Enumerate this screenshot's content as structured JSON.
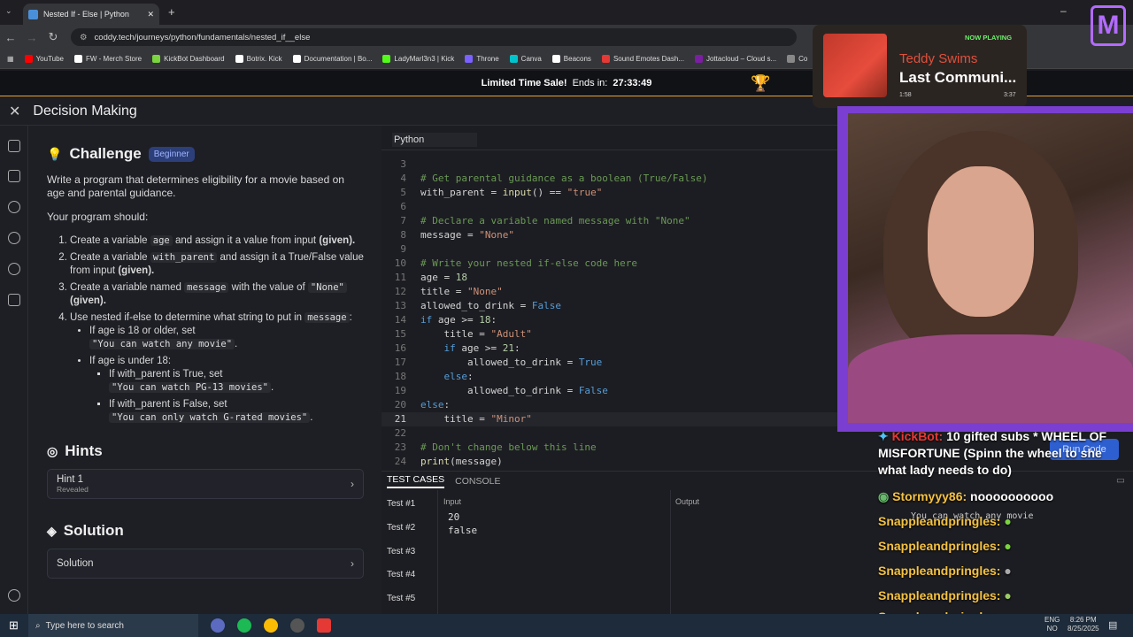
{
  "browser": {
    "tab_title": "Nested If - Else | Python",
    "url": "coddy.tech/journeys/python/fundamentals/nested_if__else",
    "bookmarks": [
      "YouTube",
      "FW - Merch Store",
      "KickBot Dashboard",
      "Botrix. Kick",
      "Documentation | Bo...",
      "LadyMarl3n3 | Kick",
      "Throne",
      "Canva",
      "Beacons",
      "Sound Emotes Dash...",
      "Jottacloud – Cloud s...",
      "Co"
    ],
    "bookmark_colors": [
      "#ff0000",
      "#ffffff",
      "#7ad53e",
      "#ffffff",
      "#ffffff",
      "#53fc18",
      "#7b61ff",
      "#00c4cc",
      "#ffffff",
      "#e53935",
      "#7b1fa2",
      "#888888"
    ]
  },
  "sale": {
    "label": "Limited Time Sale!",
    "ends": "Ends in:",
    "timer": "27:33:49"
  },
  "app": {
    "title": "Decision Making"
  },
  "challenge": {
    "title": "Challenge",
    "level": "Beginner",
    "intro": "Write a program that determines eligibility for a movie based on age and parental guidance.",
    "should": "Your program should:",
    "step1a": "Create a variable",
    "step1code": "age",
    "step1b": "and assign it a value from input",
    "step1given": "(given).",
    "step2a": "Create a variable",
    "step2code": "with_parent",
    "step2b": "and assign it a True/False value from input",
    "step2given": "(given).",
    "step3a": "Create a variable named",
    "step3code": "message",
    "step3b": "with the value of",
    "step3code2": "\"None\"",
    "step3given": "(given).",
    "step4a": "Use nested if-else to determine what string to put in",
    "step4code": "message",
    "step4b": ":",
    "sub1": "If age is 18 or older, set",
    "sub1code": "\"You can watch any movie\"",
    "sub2": "If age is under 18:",
    "subsub1": "If with_parent is True, set",
    "subsub1code": "\"You can watch PG-13 movies\"",
    "subsub2": "If with_parent is False, set",
    "subsub2code": "\"You can only watch G-rated movies\""
  },
  "hints": {
    "title": "Hints",
    "item_label": "Hint 1",
    "item_status": "Revealed"
  },
  "solution": {
    "title": "Solution",
    "item_label": "Solution"
  },
  "editor": {
    "language": "Python"
  },
  "tests": {
    "tab_cases": "TEST CASES",
    "tab_console": "CONSOLE",
    "col_input": "Input",
    "col_output": "Output",
    "items": [
      "Test #1",
      "Test #2",
      "Test #3",
      "Test #4",
      "Test #5"
    ],
    "input_line1": "20",
    "input_line2": "false"
  },
  "run_button": "Run Code",
  "expected_value": "You can watch any movie",
  "nowplaying": {
    "status": "NOW PLAYING",
    "artist": "Teddy Swims",
    "song": "Last Communi...",
    "elapsed": "1:58",
    "duration": "3:37"
  },
  "chat": {
    "bot_name": "KickBot:",
    "bot_text": "10 gifted subs * WHEEL OF MISFORTUNE (Spinn the wheel to she what lady needs to do)",
    "user1": "Stormyyy86:",
    "user1_text": "noooooooooo",
    "user2": "Snappleandpringles:"
  },
  "taskbar": {
    "search": "Type here to search",
    "lang1": "ENG",
    "lang2": "NO",
    "time": "8:26 PM",
    "date": "8/25/2025"
  }
}
